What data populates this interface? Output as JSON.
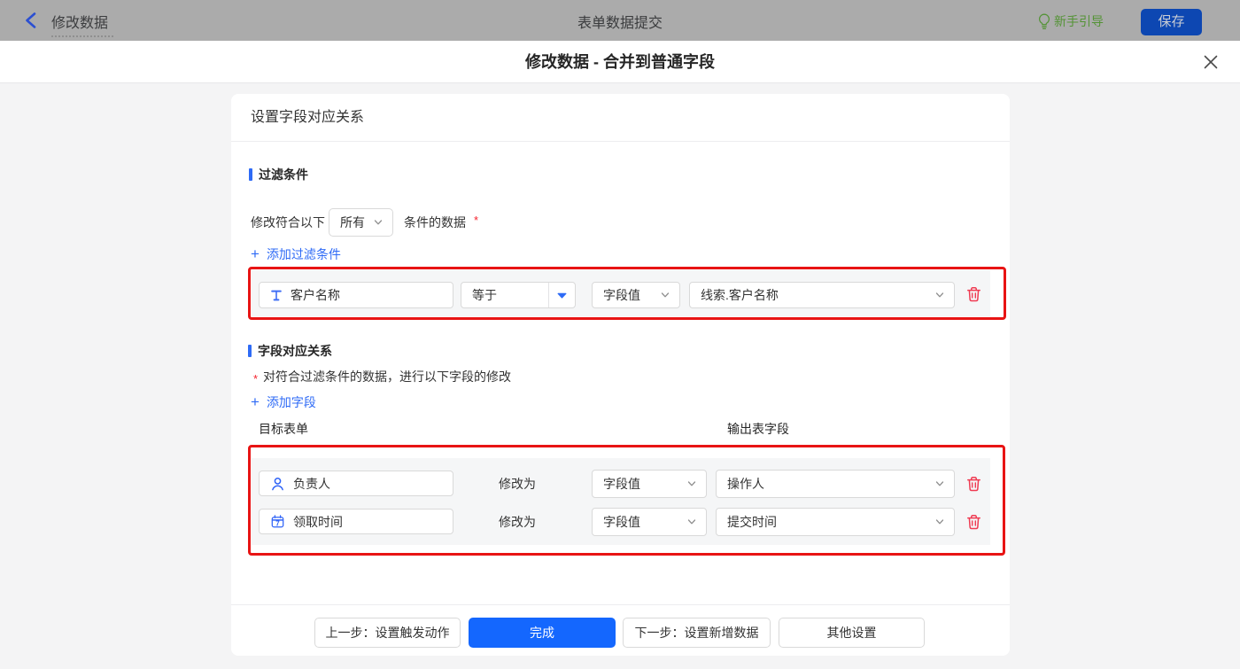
{
  "topbar": {
    "back_label": "修改数据",
    "center_title": "表单数据提交",
    "guide_label": "新手引导",
    "save_label": "保存"
  },
  "dialog": {
    "title": "修改数据 - 合并到普通字段"
  },
  "panel": {
    "header": "设置字段对应关系"
  },
  "filter": {
    "section_title": "过滤条件",
    "cond_prefix": "修改符合以下",
    "match_value": "所有",
    "cond_suffix": "条件的数据",
    "required_mark": "*",
    "add_plus": "+",
    "add_label": "添加过滤条件",
    "row": {
      "field": "客户名称",
      "operator": "等于",
      "value_type": "字段值",
      "value_field": "线索.客户名称"
    }
  },
  "mapping": {
    "section_title": "字段对应关系",
    "required_mark": "*",
    "note": "对符合过滤条件的数据，进行以下字段的修改",
    "add_plus": "+",
    "add_label": "添加字段",
    "col_source": "目标表单",
    "col_output": "输出表字段",
    "rows": [
      {
        "field": "负责人",
        "modify_label": "修改为",
        "value_type": "字段值",
        "value_field": "操作人"
      },
      {
        "field": "领取时间",
        "modify_label": "修改为",
        "value_type": "字段值",
        "value_field": "提交时间"
      }
    ]
  },
  "footer": {
    "prev_label": "上一步：设置触发动作",
    "done_label": "完成",
    "next_label": "下一步：设置新增数据",
    "other_label": "其他设置"
  },
  "colors": {
    "accent_blue": "#2e6bf6",
    "primary_button_blue": "#1467fe",
    "annotation_red": "#e81414",
    "danger_red": "#f5222d",
    "guide_green": "#549336",
    "topbar_gray": "#ababab"
  }
}
